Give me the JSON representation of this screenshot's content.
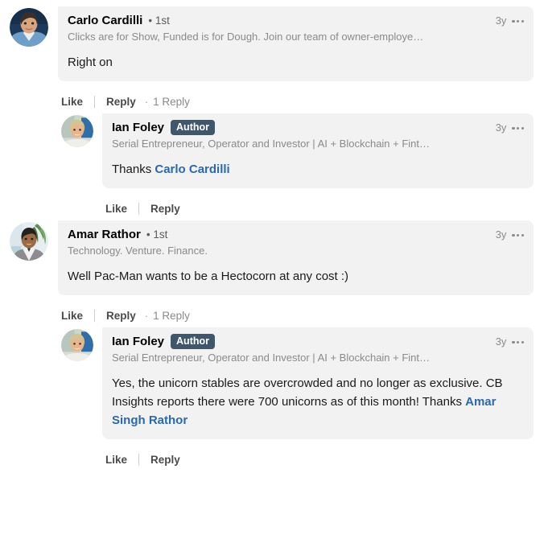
{
  "thread": {
    "comments": [
      {
        "id": "comment-carlo",
        "is_reply": false,
        "author": "Carlo Cardilli",
        "degree": "• 1st",
        "badge": "",
        "headline": "Clicks are for Show, Funded is for Dough. Join our team of owner-employe…",
        "timestamp": "3y",
        "text_before": "Right on",
        "mention": "",
        "text_after": "",
        "like_label": "Like",
        "reply_label": "Reply",
        "reply_dot": "·",
        "reply_count": "1 Reply",
        "menu_icon": "overflow-menu-icon",
        "avatar": "avatar-carlo-cardilli"
      },
      {
        "id": "comment-ian-1",
        "is_reply": true,
        "author": "Ian Foley",
        "degree": "",
        "badge": "Author",
        "headline": "Serial Entrepreneur, Operator and Investor | AI + Blockchain + Fint…",
        "timestamp": "3y",
        "text_before": "Thanks ",
        "mention": "Carlo Cardilli",
        "text_after": "",
        "like_label": "Like",
        "reply_label": "Reply",
        "reply_dot": "",
        "reply_count": "",
        "menu_icon": "overflow-menu-icon",
        "avatar": "avatar-ian-foley"
      },
      {
        "id": "comment-amar",
        "is_reply": false,
        "author": "Amar Rathor",
        "degree": "• 1st",
        "badge": "",
        "headline": "Technology. Venture. Finance.",
        "timestamp": "3y",
        "text_before": "Well Pac-Man wants to be a Hectocorn at any cost :)",
        "mention": "",
        "text_after": "",
        "like_label": "Like",
        "reply_label": "Reply",
        "reply_dot": "·",
        "reply_count": "1 Reply",
        "menu_icon": "overflow-menu-icon",
        "avatar": "avatar-amar-rathor"
      },
      {
        "id": "comment-ian-2",
        "is_reply": true,
        "author": "Ian Foley",
        "degree": "",
        "badge": "Author",
        "headline": "Serial Entrepreneur, Operator and Investor | AI + Blockchain + Fint…",
        "timestamp": "3y",
        "text_before": "Yes, the unicorn stables are overcrowded and no longer as exclusive. CB Insights reports there were 700 unicorns as of this month! Thanks ",
        "mention": "Amar Singh Rathor",
        "text_after": "",
        "like_label": "Like",
        "reply_label": "Reply",
        "reply_dot": "",
        "reply_count": "",
        "menu_icon": "overflow-menu-icon",
        "avatar": "avatar-ian-foley"
      }
    ]
  },
  "colors": {
    "bubble_bg": "#f2f2f2",
    "mention_blue": "#2c68ad",
    "author_badge_bg": "#40566b",
    "muted_text": "#8a8a8a",
    "action_text": "#4a4a4a",
    "page_bg": "#ffffff"
  }
}
